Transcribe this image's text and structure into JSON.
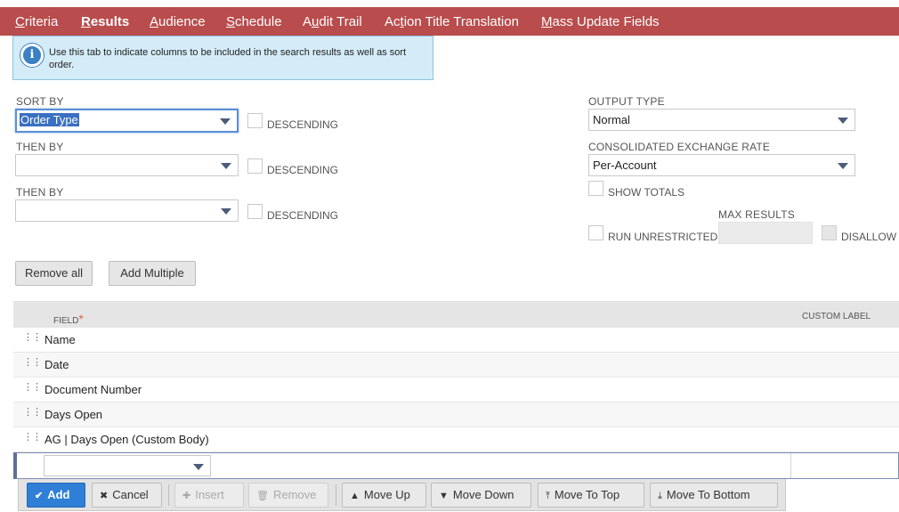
{
  "tabs": [
    {
      "label": "Criteria",
      "key": "C",
      "rest": "riteria"
    },
    {
      "label": "Results",
      "key": "R",
      "rest": "esults"
    },
    {
      "label": "Audience",
      "key": "A",
      "rest": "udience"
    },
    {
      "label": "Schedule",
      "key": "S",
      "rest": "chedule"
    },
    {
      "label": "Audit Trail",
      "pre": "A",
      "key": "u",
      "rest": "dit Trail"
    },
    {
      "label": "Action Title Translation",
      "pre": "Ac",
      "key": "t",
      "rest": "ion Title Translation"
    },
    {
      "label": "Mass Update Fields",
      "key": "M",
      "rest": "ass Update Fields"
    }
  ],
  "info": {
    "text": "Use this tab to indicate columns to be included in the search results as well as sort order."
  },
  "sort": {
    "sort_by_label": "SORT BY",
    "sort_by_value": "Order Type",
    "then_by_label_1": "THEN BY",
    "then_by_value_1": "",
    "then_by_label_2": "THEN BY",
    "then_by_value_2": "",
    "descending_label": "DESCENDING"
  },
  "output": {
    "output_type_label": "OUTPUT TYPE",
    "output_type_value": "Normal",
    "exchange_rate_label": "CONSOLIDATED EXCHANGE RATE",
    "exchange_rate_value": "Per-Account",
    "show_totals_label": "SHOW TOTALS",
    "max_results_label": "MAX RESULTS",
    "run_unrestricted_label": "RUN UNRESTRICTED",
    "disallow_label": "DISALLOW"
  },
  "list_buttons": {
    "remove_all": "Remove all",
    "add_multiple": "Add Multiple"
  },
  "grid": {
    "field_header": "FIELD",
    "required_mark": "*",
    "custom_label_header": "CUSTOM LABEL",
    "rows": [
      "Name",
      "Date",
      "Document Number",
      "Days Open",
      "AG | Days Open (Custom Body)"
    ]
  },
  "actions": {
    "add": "Add",
    "cancel": "Cancel",
    "insert": "Insert",
    "remove": "Remove",
    "move_up": "Move Up",
    "move_down": "Move Down",
    "move_to_top": "Move To Top",
    "move_to_bottom": "Move To Bottom"
  },
  "colors": {
    "tab_bar": "#b94c4c",
    "info_bg": "#d4ecf8",
    "primary_button": "#2f7fd6"
  }
}
